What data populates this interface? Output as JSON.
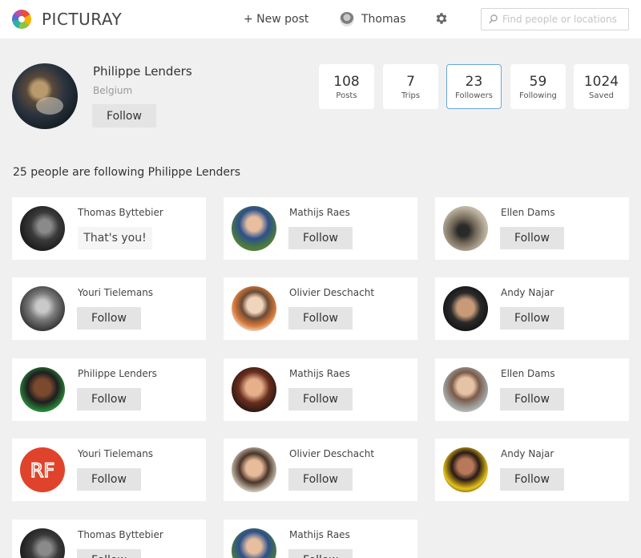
{
  "header": {
    "brand": "PICTURAY",
    "new_post": "+ New post",
    "user_name": "Thomas",
    "search_placeholder": "Find people or locations"
  },
  "profile": {
    "name": "Philippe Lenders",
    "location": "Belgium",
    "follow_label": "Follow",
    "stats": [
      {
        "value": "108",
        "label": "Posts"
      },
      {
        "value": "7",
        "label": "Trips"
      },
      {
        "value": "23",
        "label": "Followers"
      },
      {
        "value": "59",
        "label": "Following"
      },
      {
        "value": "1024",
        "label": "Saved"
      }
    ],
    "active_stat": "Followers"
  },
  "followers_title": "25 people are following Philippe Lenders",
  "followers": [
    {
      "name": "Thomas Byttebier",
      "action": "That's you!"
    },
    {
      "name": "Mathijs Raes",
      "action": "Follow"
    },
    {
      "name": "Ellen Dams",
      "action": "Follow"
    },
    {
      "name": "Youri Tielemans",
      "action": "Follow"
    },
    {
      "name": "Olivier Deschacht",
      "action": "Follow"
    },
    {
      "name": "Andy Najar",
      "action": "Follow"
    },
    {
      "name": "Philippe Lenders",
      "action": "Follow"
    },
    {
      "name": "Mathijs Raes",
      "action": "Follow"
    },
    {
      "name": "Ellen Dams",
      "action": "Follow"
    },
    {
      "name": "Youri Tielemans",
      "action": "Follow"
    },
    {
      "name": "Olivier Deschacht",
      "action": "Follow"
    },
    {
      "name": "Andy Najar",
      "action": "Follow"
    },
    {
      "name": "Thomas Byttebier",
      "action": "Follow"
    },
    {
      "name": "Mathijs Raes",
      "action": "Follow"
    }
  ],
  "avatar_logo_text": "RF",
  "colors": {
    "background": "#f0f0f0",
    "card": "#ffffff",
    "button": "#e4e4e4",
    "active_border": "#6aa8d8",
    "logo_badge": "#e0432b"
  }
}
